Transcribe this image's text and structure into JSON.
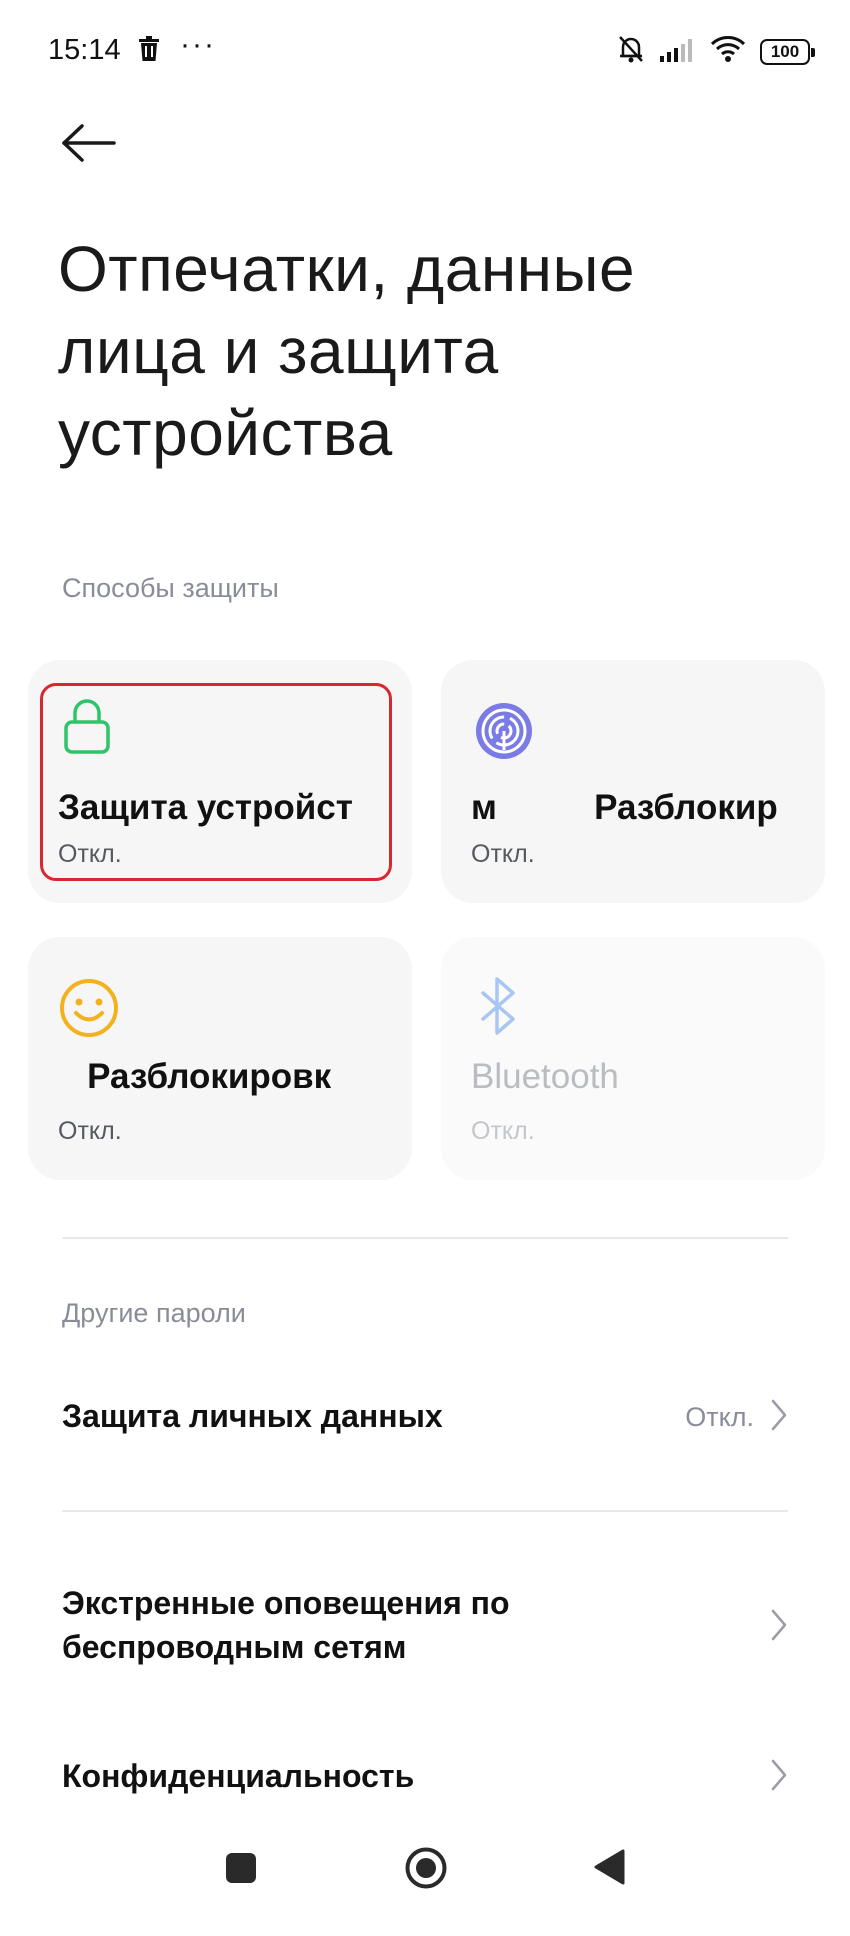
{
  "status_bar": {
    "time": "15:14",
    "more": "···",
    "battery": "100"
  },
  "header": {
    "title": "Отпечатки, данные лица и защита устройства"
  },
  "sections": {
    "protection_methods": "Способы защиты",
    "other_passwords": "Другие пароли"
  },
  "cards": [
    {
      "title": "Защита устройст",
      "value": "Откл.",
      "icon": "lock-icon",
      "icon_color": "#2ec56a"
    },
    {
      "title": "м          Разблокир",
      "value": "Откл.",
      "icon": "fingerprint-icon",
      "icon_color": "#7b7be6"
    },
    {
      "title": "   Разблокировк",
      "value": "Откл.",
      "icon": "face-icon",
      "icon_color": "#f3b21d"
    },
    {
      "title": "Bluetooth",
      "value": "Откл.",
      "icon": "bluetooth-icon",
      "icon_color": "#a9c6f3"
    }
  ],
  "rows": [
    {
      "label": "Защита личных данных",
      "value": "Откл."
    },
    {
      "label": "Экстренные оповещения по беспроводным сетям",
      "value": ""
    },
    {
      "label": "Конфиденциальность",
      "value": ""
    }
  ],
  "colors": {
    "highlight": "#d8282f",
    "card_bg": "#f6f6f6",
    "section_label": "#8a8d99"
  }
}
